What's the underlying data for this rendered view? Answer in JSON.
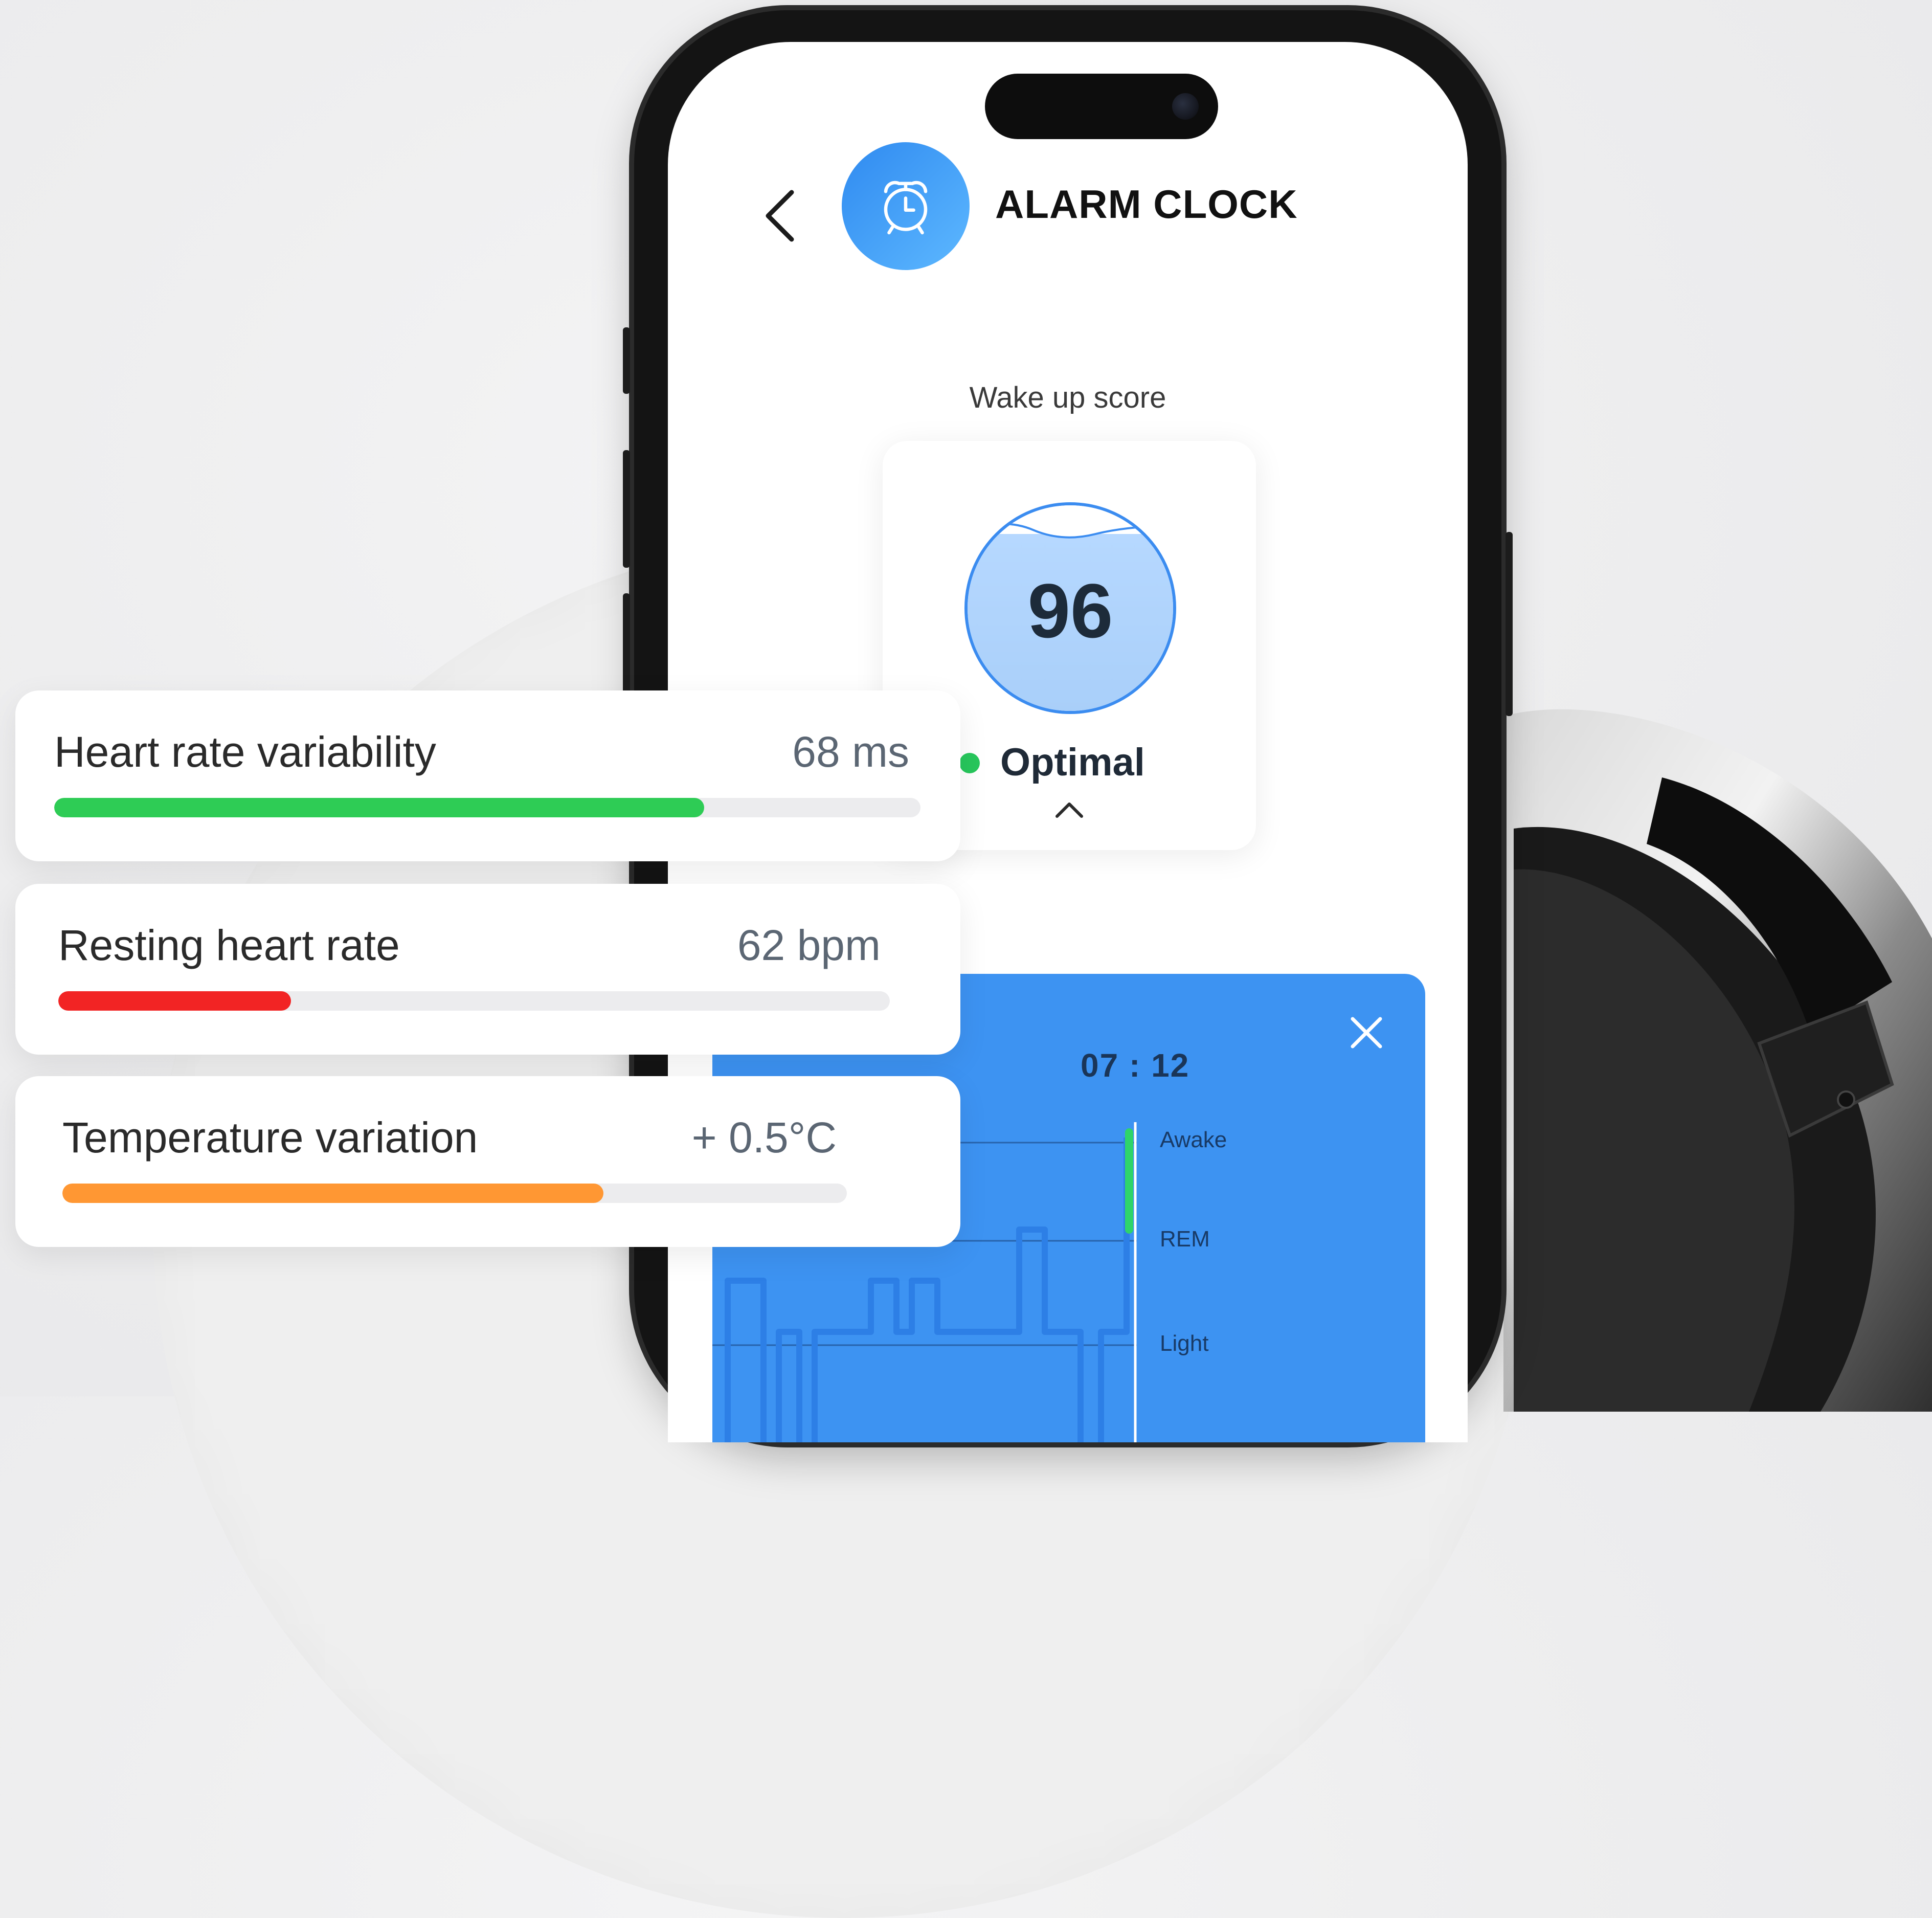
{
  "screen": {
    "title": "ALARM CLOCK",
    "back_icon": "chevron-left-icon",
    "badge_icon": "alarm-clock-icon",
    "accent_color": "#3b8cf0"
  },
  "wake_score": {
    "label": "Wake up score",
    "value": "96",
    "fraction": 0.96,
    "status": "Optimal",
    "status_color": "#27c75c",
    "expand_icon": "chevron-up-icon"
  },
  "sleep_panel": {
    "time": "07 : 12",
    "close_icon": "close-icon",
    "background_color": "#3d93f2",
    "stages": [
      "Awake",
      "REM",
      "Light"
    ]
  },
  "metrics": [
    {
      "name": "Heart rate variability",
      "value": "68 ms",
      "level": 0.75,
      "color": "#2ecc55"
    },
    {
      "name": "Resting heart rate",
      "value": "62 bpm",
      "level": 0.28,
      "color": "#f22424"
    },
    {
      "name": "Temperature variation",
      "value": "+ 0.5°C",
      "level": 0.69,
      "color": "#ff9733"
    }
  ]
}
